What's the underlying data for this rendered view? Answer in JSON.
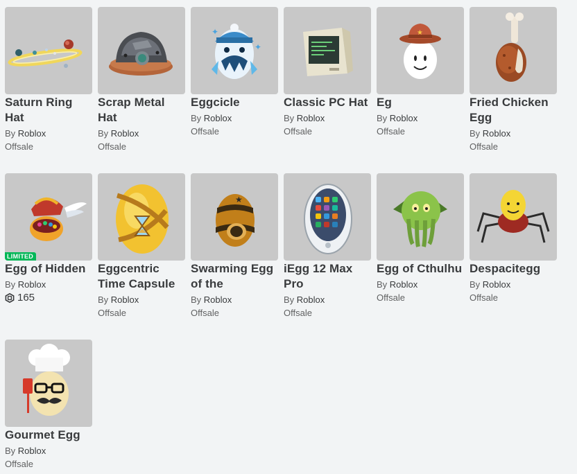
{
  "colors": {
    "background": "#f2f4f5",
    "thumbnail_bg": "#c8c8c8",
    "limited_badge": "#02b757",
    "text_primary": "#393b3d",
    "text_secondary": "#606162"
  },
  "items": [
    {
      "name": "Saturn Ring Hat",
      "by": "By",
      "creator": "Roblox",
      "price": "Offsale",
      "icon": "saturn-ring-hat-icon"
    },
    {
      "name": "Scrap Metal Hat",
      "by": "By",
      "creator": "Roblox",
      "price": "Offsale",
      "icon": "scrap-metal-hat-icon"
    },
    {
      "name": "Eggcicle",
      "by": "By",
      "creator": "Roblox",
      "price": "Offsale",
      "icon": "eggcicle-icon"
    },
    {
      "name": "Classic PC Hat",
      "by": "By",
      "creator": "Roblox",
      "price": "Offsale",
      "icon": "classic-pc-hat-icon"
    },
    {
      "name": "Eg",
      "by": "By",
      "creator": "Roblox",
      "price": "Offsale",
      "icon": "eg-egg-icon"
    },
    {
      "name": "Fried Chicken Egg",
      "by": "By",
      "creator": "Roblox",
      "price": "Offsale",
      "icon": "fried-chicken-egg-icon"
    },
    {
      "name": "Egg of Hidden",
      "by": "By",
      "creator": "Roblox",
      "price": "165",
      "badge": "LIMITED",
      "icon": "egg-of-hidden-icon"
    },
    {
      "name": "Eggcentric Time Capsule",
      "by": "By",
      "creator": "Roblox",
      "price": "Offsale",
      "icon": "eggcentric-time-capsule-icon"
    },
    {
      "name": "Swarming Egg of the",
      "by": "By",
      "creator": "Roblox",
      "price": "Offsale",
      "icon": "swarming-egg-icon"
    },
    {
      "name": "iEgg 12 Max Pro",
      "by": "By",
      "creator": "Roblox",
      "price": "Offsale",
      "icon": "iegg-icon"
    },
    {
      "name": "Egg of Cthulhu",
      "by": "By",
      "creator": "Roblox",
      "price": "Offsale",
      "icon": "egg-of-cthulhu-icon"
    },
    {
      "name": "Despacitegg",
      "by": "By",
      "creator": "Roblox",
      "price": "Offsale",
      "icon": "despacitegg-icon"
    },
    {
      "name": "Gourmet Egg",
      "by": "By",
      "creator": "Roblox",
      "price": "Offsale",
      "icon": "gourmet-egg-icon"
    }
  ]
}
